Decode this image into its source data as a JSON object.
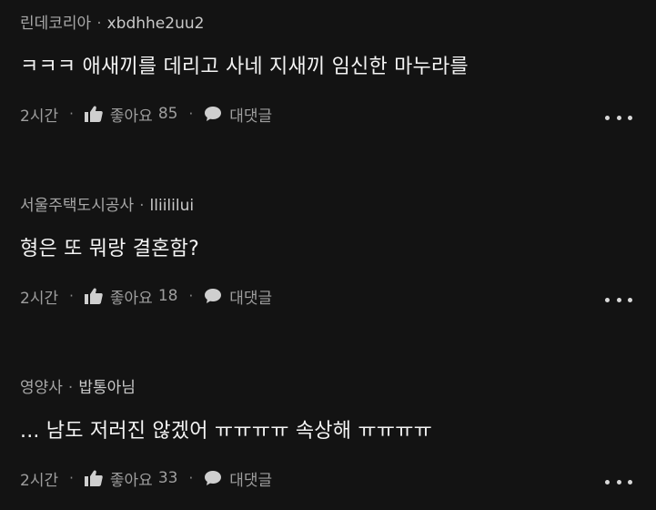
{
  "ui": {
    "dot_sep": "·",
    "time_label": "2시간",
    "like_label": "좋아요",
    "reply_label": "대댓글"
  },
  "comments": [
    {
      "author": "린데코리아",
      "handle": "xbdhhe2uu2",
      "text": "ㅋㅋㅋ 애새끼를 데리고 사네  지새끼 임신한 마누라를",
      "likes": "85"
    },
    {
      "author": "서울주택도시공사",
      "handle": "lliililui",
      "text": "형은 또 뭐랑 결혼함?",
      "likes": "18"
    },
    {
      "author": "영양사",
      "handle": "밥통아님",
      "text": "... 남도 저러진 않겠어 ㅠㅠㅠㅠ 속상해 ㅠㅠㅠㅠ",
      "likes": "33"
    }
  ],
  "icons": {
    "like": "thumbs-up-icon",
    "reply": "speech-bubble-icon",
    "more": "more-horizontal-icon"
  },
  "colors": {
    "background": "#131313",
    "text_primary": "#f4f4f4",
    "text_secondary": "#a8a8a8"
  }
}
